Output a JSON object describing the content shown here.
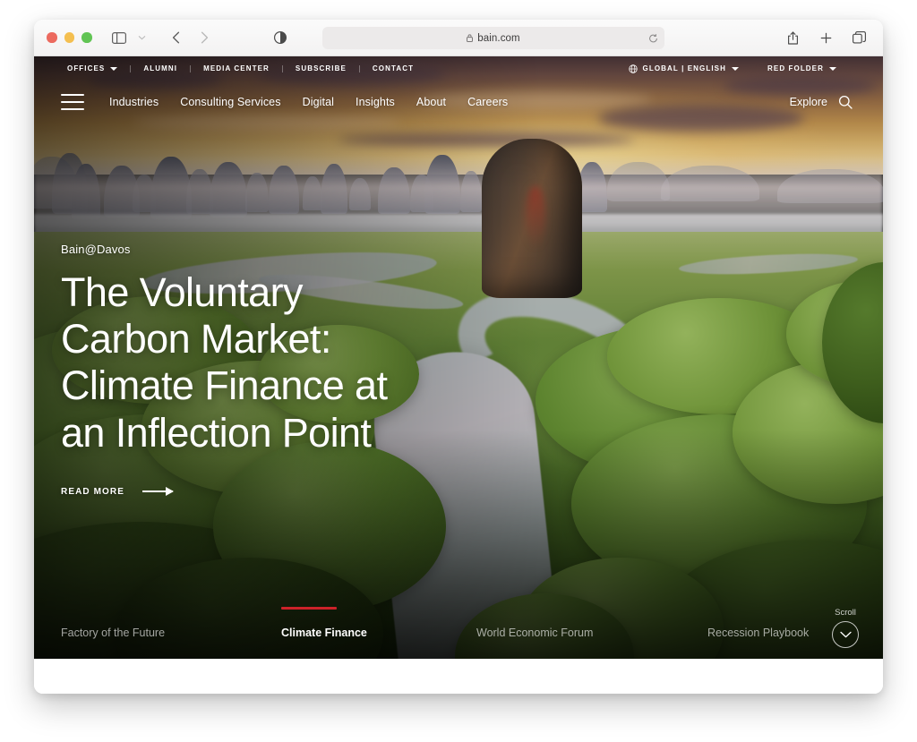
{
  "browser": {
    "url": "bain.com",
    "lock_icon": "lock-icon",
    "reload_icon": "reload-icon",
    "sidebar_icon": "sidebar-toggle-icon",
    "sidebar_chevron_icon": "chevron-down-icon",
    "back_icon": "back-arrow-icon",
    "forward_icon": "forward-arrow-icon",
    "reader_icon": "reader-mode-icon",
    "share_icon": "share-icon",
    "newtab_icon": "plus-icon",
    "tabs_icon": "tab-overview-icon",
    "traffic_lights": [
      "close",
      "minimize",
      "zoom"
    ]
  },
  "site": {
    "utility_nav": [
      {
        "label": "OFFICES",
        "has_caret": true
      },
      {
        "label": "ALUMNI",
        "has_caret": false
      },
      {
        "label": "MEDIA CENTER",
        "has_caret": false
      },
      {
        "label": "SUBSCRIBE",
        "has_caret": false
      },
      {
        "label": "CONTACT",
        "has_caret": false
      }
    ],
    "utility_right": [
      {
        "label": "GLOBAL | ENGLISH",
        "has_caret": true,
        "icon": "globe-icon"
      },
      {
        "label": "RED FOLDER",
        "has_caret": true,
        "icon": ""
      }
    ],
    "main_nav": [
      {
        "label": "Industries"
      },
      {
        "label": "Consulting Services"
      },
      {
        "label": "Digital"
      },
      {
        "label": "Insights"
      },
      {
        "label": "About"
      },
      {
        "label": "Careers"
      }
    ],
    "nav_right": {
      "explore_label": "Explore",
      "search_icon": "search-icon"
    },
    "menu_icon": "hamburger-menu-icon"
  },
  "hero": {
    "eyebrow": "Bain@Davos",
    "headline": "The Voluntary Carbon Market: Climate Finance at an Inflection Point",
    "cta_label": "READ MORE",
    "cta_icon": "arrow-right-icon"
  },
  "carousel": {
    "tabs": [
      {
        "label": "Factory of the Future",
        "active": false
      },
      {
        "label": "Climate Finance",
        "active": true
      },
      {
        "label": "World Economic Forum",
        "active": false
      },
      {
        "label": "Recession Playbook",
        "active": false
      }
    ],
    "scroll_label": "Scroll",
    "scroll_icon": "chevron-down-icon",
    "active_indicator_color": "#cc2229"
  }
}
